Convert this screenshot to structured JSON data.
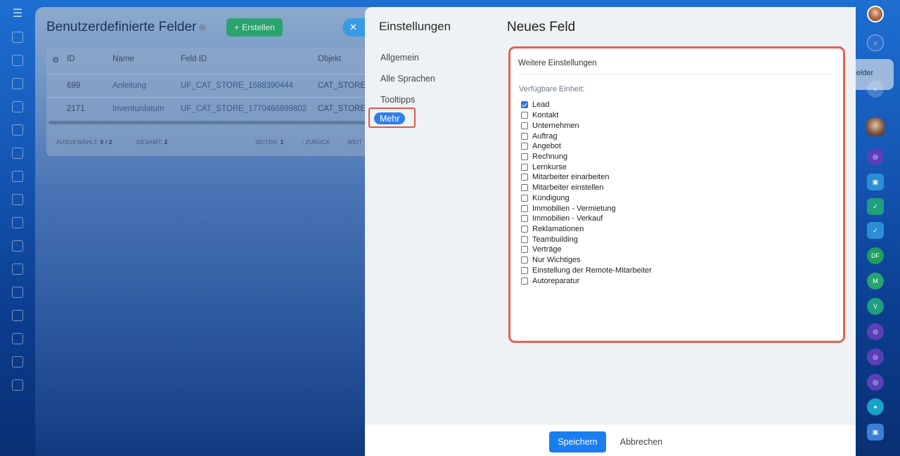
{
  "background_page": {
    "title": "Benutzerdefinierte Felder",
    "create_button": "Erstellen",
    "columns": [
      "ID",
      "Name",
      "Feld ID",
      "Objekt"
    ],
    "rows": [
      {
        "id": "699",
        "name": "Anleitung",
        "field_id": "UF_CAT_STORE_1688390444",
        "object": "CAT_STORE"
      },
      {
        "id": "2171",
        "name": "Inventurdatum",
        "field_id": "UF_CAT_STORE_1770466899802",
        "object": "CAT_STORE"
      }
    ],
    "footer": {
      "selected_label": "AUSGEWÄHLT:",
      "selected_value": "0 / 2",
      "total_label": "GESAMT:",
      "total_value": "2",
      "pages_label": "SEITEN:",
      "pages_value": "1",
      "back": "ZURÜCK",
      "next": "WEIT"
    }
  },
  "right_rail": {
    "felder_tab": "Felder",
    "letters": [
      "DF",
      "M",
      "V"
    ]
  },
  "panel": {
    "nav_title": "Einstellungen",
    "nav_items": [
      "Allgemein",
      "Alle Sprachen",
      "Tooltipps",
      "Mehr"
    ],
    "active_nav": "Mehr",
    "title": "Neues Feld",
    "section_title": "Weitere Einstellungen",
    "available_label": "Verfügbare Einheit:",
    "units": [
      {
        "label": "Lead",
        "checked": true
      },
      {
        "label": "Kontakt",
        "checked": false
      },
      {
        "label": "Unternehmen",
        "checked": false
      },
      {
        "label": "Auftrag",
        "checked": false
      },
      {
        "label": "Angebot",
        "checked": false
      },
      {
        "label": "Rechnung",
        "checked": false
      },
      {
        "label": "Lernkurse",
        "checked": false
      },
      {
        "label": "Mitarbeiter einarbeiten",
        "checked": false
      },
      {
        "label": "Mitarbeiter einstellen",
        "checked": false
      },
      {
        "label": "Kündigung",
        "checked": false
      },
      {
        "label": "Immobilien - Vermietung",
        "checked": false
      },
      {
        "label": "Immobilien - Verkauf",
        "checked": false
      },
      {
        "label": "Reklamationen",
        "checked": false
      },
      {
        "label": "Teambuilding",
        "checked": false
      },
      {
        "label": "Verträge",
        "checked": false
      },
      {
        "label": "Nur Wichtiges",
        "checked": false
      },
      {
        "label": "Einstellung der Remote-Mitarbeiter",
        "checked": false
      },
      {
        "label": "Autoreparatur",
        "checked": false
      }
    ],
    "save_button": "Speichern",
    "cancel_button": "Abbrechen"
  },
  "colors": {
    "accent": "#1a7ef2",
    "highlight_border": "#e06354",
    "create_green": "#2aa36f"
  }
}
